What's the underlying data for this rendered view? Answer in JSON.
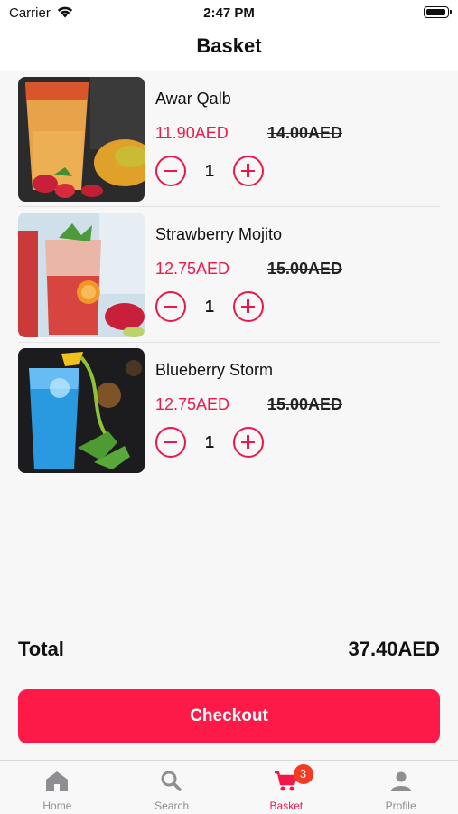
{
  "status_bar": {
    "carrier": "Carrier",
    "time": "2:47 PM"
  },
  "header": {
    "title": "Basket"
  },
  "items": [
    {
      "name": "Awar Qalb",
      "price": "11.90AED",
      "old_price": "14.00AED",
      "quantity": "1"
    },
    {
      "name": "Strawberry Mojito",
      "price": "12.75AED",
      "old_price": "15.00AED",
      "quantity": "1"
    },
    {
      "name": "Blueberry Storm",
      "price": "12.75AED",
      "old_price": "15.00AED",
      "quantity": "1"
    }
  ],
  "total": {
    "label": "Total",
    "value": "37.40AED"
  },
  "checkout": {
    "label": "Checkout"
  },
  "tabs": [
    {
      "label": "Home",
      "icon": "home-icon"
    },
    {
      "label": "Search",
      "icon": "search-icon"
    },
    {
      "label": "Basket",
      "icon": "cart-icon",
      "badge": "3",
      "active": true
    },
    {
      "label": "Profile",
      "icon": "person-icon"
    }
  ],
  "colors": {
    "accent": "#fd1a48",
    "price": "#f0194a",
    "badge": "#f33a22",
    "inactive": "#8e8e93"
  }
}
